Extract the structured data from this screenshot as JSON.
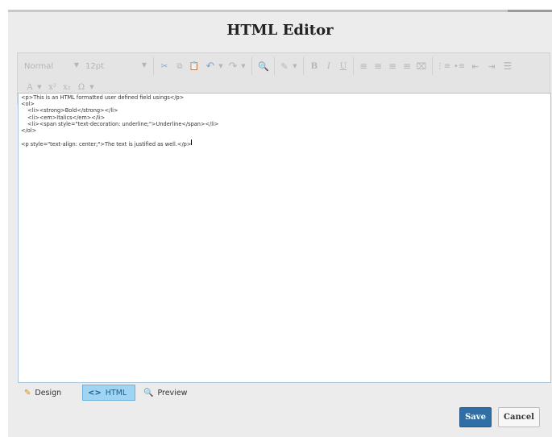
{
  "dialog": {
    "title": "HTML Editor"
  },
  "toolbar": {
    "format_select": "Normal",
    "size_select": "12pt",
    "icons": {
      "cut": "✂",
      "copy": "⧉",
      "paste": "📋",
      "undo": "↶",
      "redo": "↷",
      "find": "🔍",
      "highlight": "✎",
      "bold": "B",
      "italic": "I",
      "underline": "U",
      "align_left": "≡",
      "align_center": "≡",
      "align_right": "≡",
      "justify": "≡",
      "clear_format": "⌧",
      "numbered_list": "⋮≡",
      "bullet_list": "•≡",
      "outdent": "⇤",
      "indent": "⇥",
      "horizontal_rule": "☰",
      "font_color": "A",
      "superscript": "x²",
      "subscript": "x₂",
      "special_char": "Ω"
    }
  },
  "editor": {
    "lines": [
      "<p>This is an HTML formatted user defined field usings</p>",
      "<ol>",
      "<li><strong>Bold</strong></li>",
      "<li><em>Italics</em></li>",
      "<li><span style=\"text-decoration: underline;\">Underline</span></li>",
      "</ol>",
      "<p style=\"text-align: center;\">The text is justified as well.</p>"
    ]
  },
  "tabs": [
    {
      "label": "Design",
      "icon": "✎"
    },
    {
      "label": "HTML",
      "icon": "<>"
    },
    {
      "label": "Preview",
      "icon": "🔍"
    }
  ],
  "buttons": {
    "save": "Save",
    "cancel": "Cancel"
  },
  "colors": {
    "accent": "#2f6fa6",
    "active_tab": "#9fd4f2",
    "editor_border": "#a9c4dc"
  }
}
